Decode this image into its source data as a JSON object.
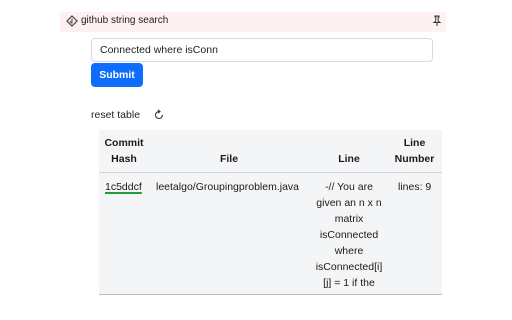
{
  "app": {
    "title": "github string search"
  },
  "search": {
    "value": "Connected where isConn"
  },
  "submit": {
    "label": "Submit"
  },
  "reset": {
    "label": "reset table"
  },
  "table": {
    "headers": {
      "hash_line1": "Commit",
      "hash_line2": "Hash",
      "file": "File",
      "line": "Line",
      "number_line1": "Line",
      "number_line2": "Number"
    },
    "rows": [
      {
        "hash": "1c5ddcf",
        "file": "leetalgo/Groupingproblem.java",
        "line_lines": [
          "-// You are",
          "given an n x n",
          "matrix",
          "isConnected",
          "where",
          "isConnected[i]",
          "[j] = 1 if the"
        ],
        "number": "lines: 9"
      }
    ]
  },
  "icons": {
    "logo": "diamond-logo-icon",
    "pin": "pin-icon",
    "reset": "refresh-icon"
  },
  "colors": {
    "accent": "#0d6efd",
    "topbar": "#fdf1f1",
    "table_bg": "#f4f5f6",
    "hash_underline": "#1f9d3a"
  }
}
